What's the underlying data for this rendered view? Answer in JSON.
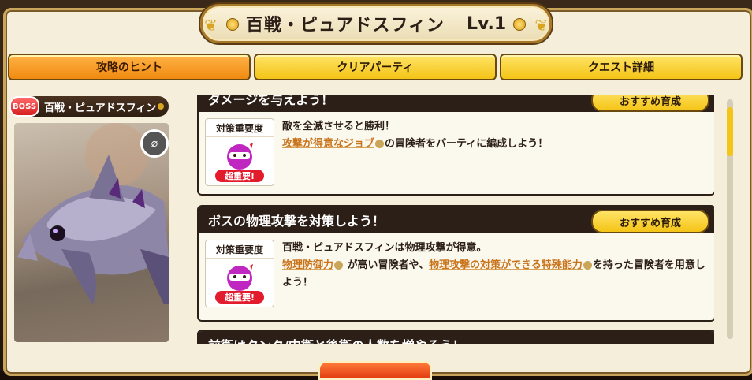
{
  "title": {
    "name": "百戦・ピュアドスフィン",
    "level": "Lv.1"
  },
  "tabs": [
    {
      "label": "攻略のヒント",
      "active": true
    },
    {
      "label": "クリアパーティ",
      "active": false
    },
    {
      "label": "クエスト詳細",
      "active": false
    }
  ],
  "boss": {
    "badge": "BOSS",
    "name": "百戦・ピュアドスフィン"
  },
  "hints": [
    {
      "heading": "ダメージを与えよう！",
      "recommend": "おすすめ育成",
      "priority_label": "対策重要度",
      "priority_tag": "超重要!",
      "line1": "敵を全滅させると勝利！",
      "kw1": "攻撃が得意なジョブ",
      "line2_rest": "の冒険者をパーティに編成しよう！"
    },
    {
      "heading": "ボスの物理攻撃を対策しよう！",
      "recommend": "おすすめ育成",
      "priority_label": "対策重要度",
      "priority_tag": "超重要!",
      "line1": "百戦・ピュアドスフィンは物理攻撃が得意。",
      "kw1": "物理防御力",
      "mid": "が高い冒険者や、",
      "kw2": "物理攻撃の対策ができる特殊能力",
      "line2_rest": "を持った冒険者を用意しよう！"
    },
    {
      "heading": "前衛はタンク/中衛と後衛の人数を増やそう！"
    }
  ],
  "colors": {
    "accent": "#f4c417",
    "active_tab": "#f08a10",
    "header": "#2c1f17",
    "keyword": "#c9741b",
    "danger": "#e21c2c"
  }
}
